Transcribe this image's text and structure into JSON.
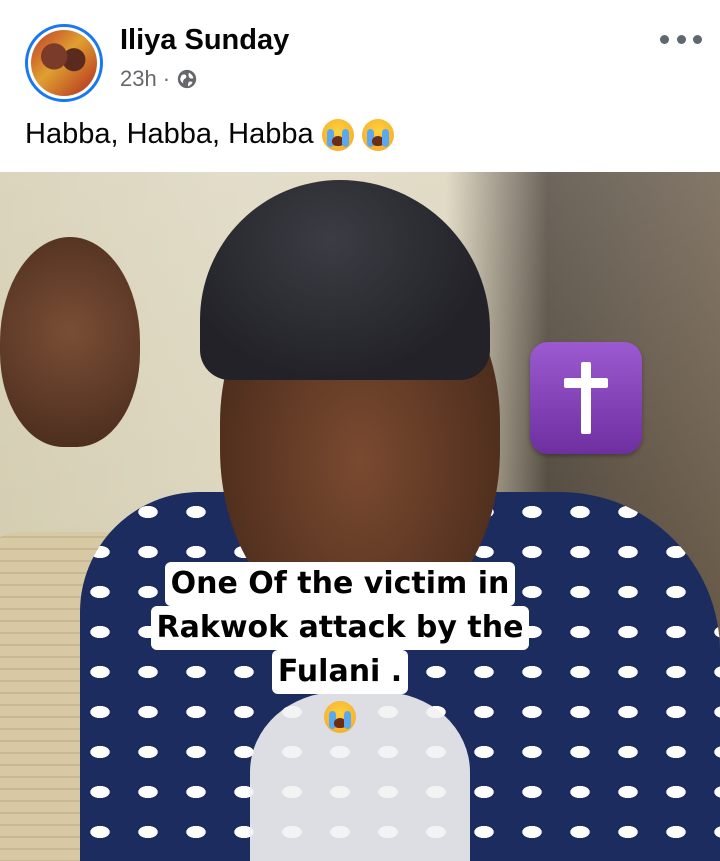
{
  "post": {
    "author": "Iliya Sunday",
    "time": "23h",
    "separator": "·",
    "privacy_icon": "globe-icon",
    "more_icon": "more-options-icon",
    "caption": "Habba, Habba, Habba",
    "caption_emoji": "loudly-crying-face-emoji"
  },
  "photo": {
    "overlay_lines": [
      "One Of the victim in",
      "Rakwok attack by the",
      "Fulani ."
    ],
    "cross_icon": "latin-cross-icon",
    "emoji": "loudly-crying-face-emoji"
  },
  "colors": {
    "avatar_ring": "#1877f2",
    "secondary_text": "#65676b",
    "cross_box": "#7e3fb5"
  }
}
